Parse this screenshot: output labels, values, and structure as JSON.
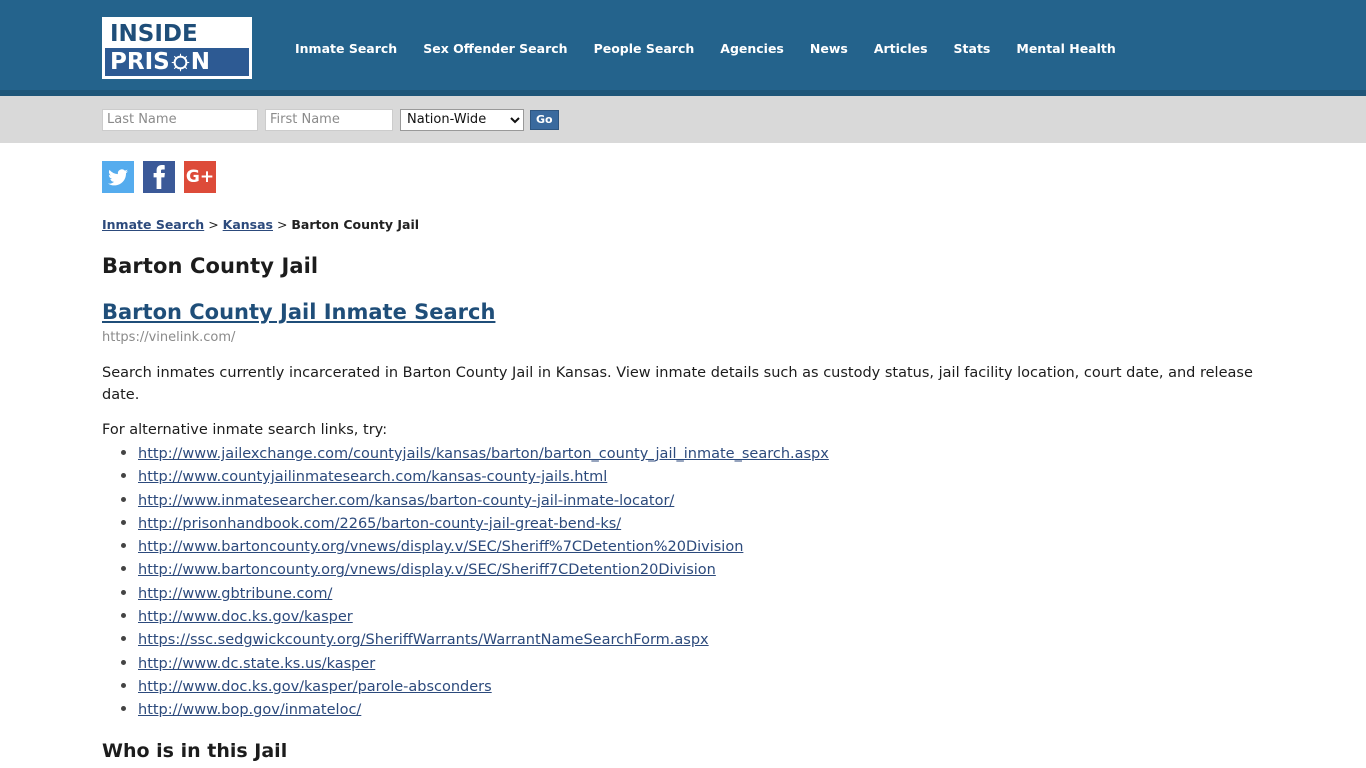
{
  "colors": {
    "header_bg": "#24638c",
    "header_strip": "#1f5679",
    "searchbar_bg": "#d9d9d9",
    "link": "#2c4a7c",
    "heading_link": "#1f4e79",
    "go_button": "#3a6a9e",
    "twitter": "#55acee",
    "facebook": "#3b5998",
    "googleplus": "#dd4b39"
  },
  "header": {
    "logo": {
      "line1": "INSIDE",
      "line2_before": "PRIS",
      "line2_after": "N",
      "globe_icon": "globe-emblem-icon"
    },
    "nav": [
      {
        "label": "Inmate Search"
      },
      {
        "label": "Sex Offender Search"
      },
      {
        "label": "People Search"
      },
      {
        "label": "Agencies"
      },
      {
        "label": "News"
      },
      {
        "label": "Articles"
      },
      {
        "label": "Stats"
      },
      {
        "label": "Mental Health"
      }
    ]
  },
  "search": {
    "last_name_placeholder": "Last Name",
    "last_name_value": "",
    "first_name_placeholder": "First Name",
    "first_name_value": "",
    "region_selected": "Nation-Wide",
    "region_options": [
      "Nation-Wide"
    ],
    "go_label": "Go"
  },
  "social": [
    {
      "name": "twitter-icon",
      "label": "Twitter"
    },
    {
      "name": "facebook-icon",
      "label": "Facebook"
    },
    {
      "name": "google-plus-icon",
      "label": "G+"
    }
  ],
  "breadcrumb": {
    "item1": "Inmate Search",
    "sep1": " > ",
    "item2": "Kansas",
    "sep2": " > ",
    "current": "Barton County Jail"
  },
  "main": {
    "page_title": "Barton County Jail",
    "result_link_title": "Barton County Jail Inmate Search",
    "result_url": "https://vinelink.com/",
    "description": "Search inmates currently incarcerated in Barton County Jail in Kansas. View inmate details such as custody status, jail facility location, court date, and release date.",
    "alt_links_intro": "For alternative inmate search links, try:",
    "alt_links": [
      "http://www.jailexchange.com/countyjails/kansas/barton/barton_county_jail_inmate_search.aspx",
      "http://www.countyjailinmatesearch.com/kansas-county-jails.html",
      "http://www.inmatesearcher.com/kansas/barton-county-jail-inmate-locator/",
      "http://prisonhandbook.com/2265/barton-county-jail-great-bend-ks/",
      "http://www.bartoncounty.org/vnews/display.v/SEC/Sheriff%7CDetention%20Division",
      "http://www.bartoncounty.org/vnews/display.v/SEC/Sheriff7CDetention20Division",
      "http://www.gbtribune.com/",
      "http://www.doc.ks.gov/kasper",
      "https://ssc.sedgwickcounty.org/SheriffWarrants/WarrantNameSearchForm.aspx",
      "http://www.dc.state.ks.us/kasper",
      "http://www.doc.ks.gov/kasper/parole-absconders",
      "http://www.bop.gov/inmateloc/"
    ],
    "section_title": "Who is in this Jail"
  }
}
